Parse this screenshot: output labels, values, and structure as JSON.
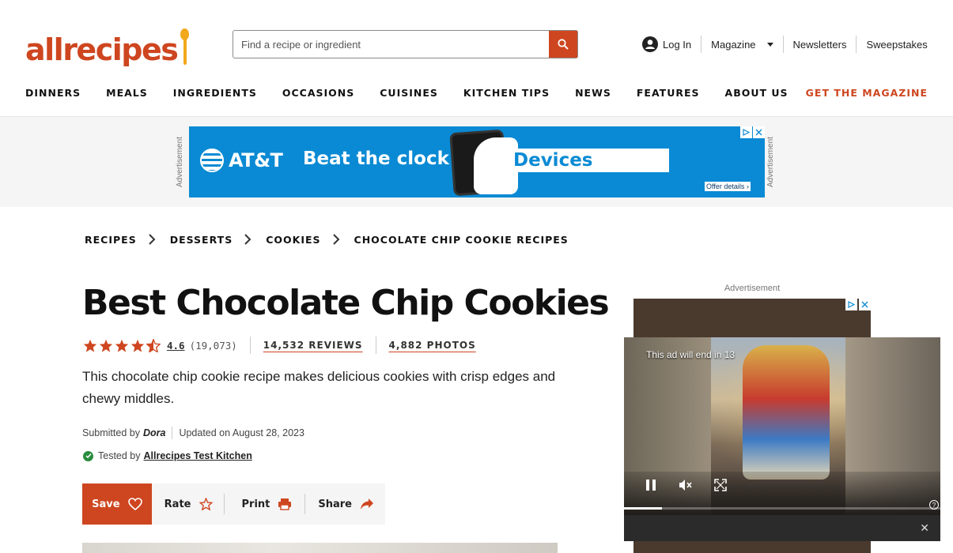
{
  "header": {
    "logo_text": "allrecipes",
    "search_placeholder": "Find a recipe or ingredient",
    "login": "Log In",
    "magazine": "Magazine",
    "newsletters": "Newsletters",
    "sweepstakes": "Sweepstakes",
    "get_magazine": "GET THE MAGAZINE",
    "accent_color": "#ce4620"
  },
  "nav": [
    "DINNERS",
    "MEALS",
    "INGREDIENTS",
    "OCCASIONS",
    "CUISINES",
    "KITCHEN TIPS",
    "NEWS",
    "FEATURES",
    "ABOUT US"
  ],
  "top_ad": {
    "label": "Advertisement",
    "brand": "AT&T",
    "headline": "Beat the clock",
    "product": "Devices",
    "offer": "Offer details"
  },
  "breadcrumb": [
    "RECIPES",
    "DESSERTS",
    "COOKIES",
    "CHOCOLATE CHIP COOKIE RECIPES"
  ],
  "recipe": {
    "title": "Best Chocolate Chip Cookies",
    "rating": "4.6",
    "rating_value": 4.6,
    "rating_count": "(19,073)",
    "reviews": "14,532 REVIEWS",
    "photos": "4,882 PHOTOS",
    "description": "This chocolate chip cookie recipe makes delicious cookies with crisp edges and chewy middles.",
    "submitted_by_label": "Submitted by",
    "author": "Dora",
    "updated": "Updated on August 28, 2023",
    "tested_by_label": "Tested by",
    "tested_by": "Allrecipes Test Kitchen"
  },
  "actions": {
    "save": "Save",
    "rate": "Rate",
    "print": "Print",
    "share": "Share"
  },
  "rail_ad": {
    "label": "Advertisement"
  },
  "video": {
    "ad_countdown": "This ad will end in 13",
    "progress": 0.12
  }
}
